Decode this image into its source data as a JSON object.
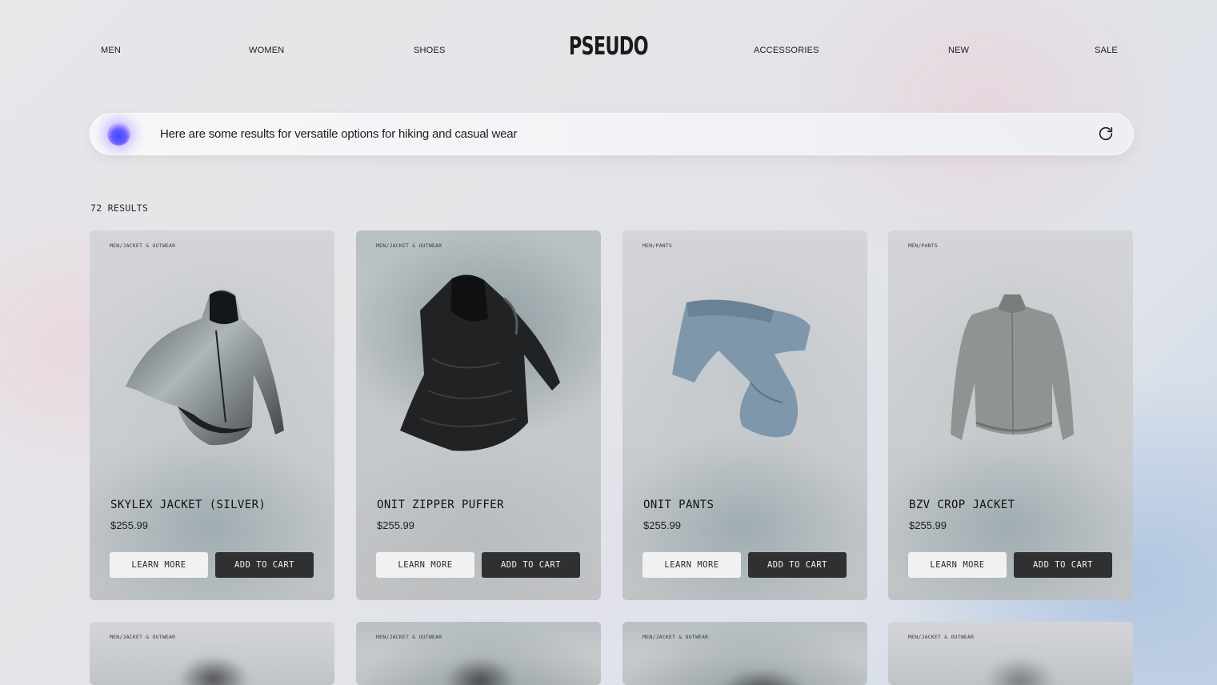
{
  "nav": {
    "logo": "PSEUDO",
    "links": [
      "MEN",
      "WOMEN",
      "SHOES",
      "ACCESSORIES",
      "NEW",
      "SALE"
    ]
  },
  "search": {
    "text": "Here are some results for versatile options for hiking and casual wear",
    "refresh_icon": "refresh-icon",
    "assistant_icon": "ai-orb-icon"
  },
  "results_count": "72 RESULTS",
  "products": [
    {
      "category": "MEN/JACKET & OUTWEAR",
      "name": "SKYLEX JACKET (SILVER)",
      "price": "$255.99",
      "learn": "LEARN MORE",
      "cart": "ADD TO CART"
    },
    {
      "category": "MEN/JACKET & OUTWEAR",
      "name": "ONIT ZIPPER PUFFER",
      "price": "$255.99",
      "learn": "LEARN MORE",
      "cart": "ADD TO CART"
    },
    {
      "category": "MEN/PANTS",
      "name": "ONIT PANTS",
      "price": "$255.99",
      "learn": "LEARN MORE",
      "cart": "ADD TO CART"
    },
    {
      "category": "MEN/PANTS",
      "name": "BZV CROP JACKET",
      "price": "$255.99",
      "learn": "LEARN MORE",
      "cart": "ADD TO CART"
    }
  ],
  "next_row": [
    {
      "category": "MEN/JACKET & OUTWEAR"
    },
    {
      "category": "MEN/JACKET & OUTWEAR"
    },
    {
      "category": "MEN/JACKET & OUTWEAR"
    },
    {
      "category": "MEN/JACKET & OUTWEAR"
    }
  ],
  "colors": {
    "primary_button": "#2f3032",
    "secondary_button": "#f1f1f2",
    "assistant_orb": "#3a4dff"
  }
}
